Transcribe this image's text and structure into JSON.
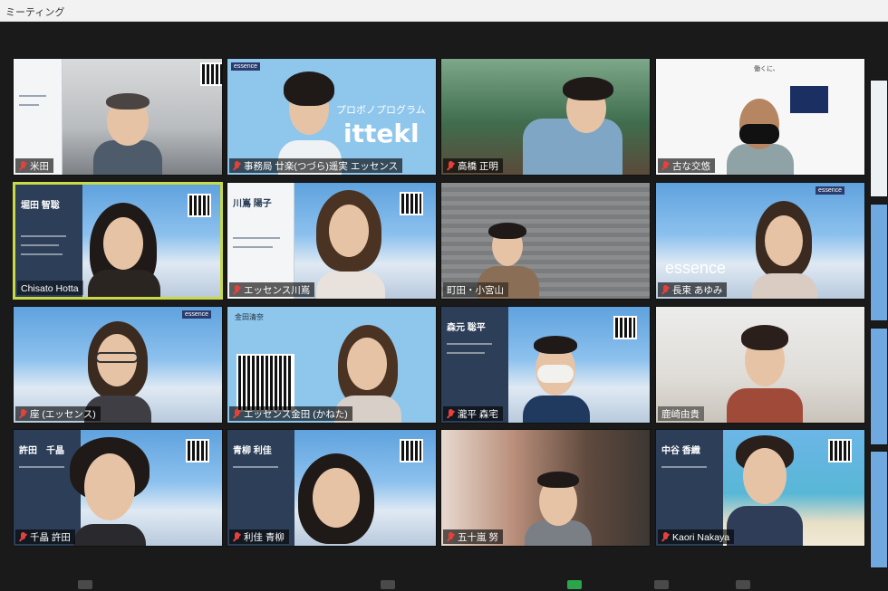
{
  "window": {
    "title": "ミーティング"
  },
  "colors": {
    "active_speaker_border": "#c8d94a",
    "muted_mic": "#e5413a",
    "toolbar_green": "#2aa54a"
  },
  "participants": [
    {
      "name": "米田",
      "muted": true
    },
    {
      "name": "事務局 廿楽(つづら)遥実 エッセンス",
      "muted": true
    },
    {
      "name": "高橋 正明",
      "muted": true
    },
    {
      "name": "古な交悠",
      "muted": true
    },
    {
      "name": "Chisato Hotta",
      "muted": false,
      "active": true
    },
    {
      "name": "エッセンス川嶌",
      "muted": true
    },
    {
      "name": "町田・小宮山",
      "muted": false
    },
    {
      "name": "長束 あゆみ",
      "muted": true
    },
    {
      "name": "座 (エッセンス)",
      "muted": true
    },
    {
      "name": "エッセンス金田 (かねた)",
      "muted": true
    },
    {
      "name": "瀧平 森宅",
      "muted": true
    },
    {
      "name": "鹿崎由貴",
      "muted": false
    },
    {
      "name": "千晶 許田",
      "muted": true
    },
    {
      "name": "利佳 青柳",
      "muted": true
    },
    {
      "name": "五十嵐 努",
      "muted": true
    },
    {
      "name": "Kaori Nakaya",
      "muted": true
    }
  ],
  "cards": {
    "r1c2_banner": "プロボノプログラム",
    "r1c2_brand": "ittekl",
    "r2c1_card_name": "堀田 智聡",
    "r2c2_card_name": "川嶌 陽子",
    "r2c4_brand": "essence",
    "r3c2_card_name": "金田清奈",
    "r3c3_card_name": "森元 聡平",
    "r4c1_card_name": "許田　千晶",
    "r4c2_card_name": "青柳 利佳",
    "r4c4_card_name": "中谷 香織",
    "r1c4_board_text": "働くに、"
  },
  "icons": {
    "mute": "muted-mic-icon"
  }
}
